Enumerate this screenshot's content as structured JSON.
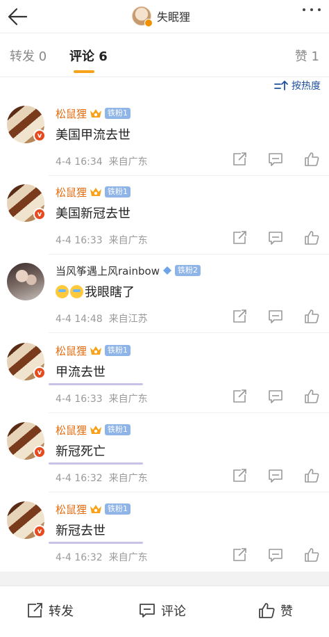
{
  "header": {
    "title": "失眠狸",
    "back_icon": "arrow-left-icon",
    "more_icon": "more-dots-icon"
  },
  "tabs": {
    "repost_label": "转发",
    "repost_count": "0",
    "comment_label": "评论",
    "comment_count": "6",
    "like_label": "赞",
    "like_count": "1",
    "active_color": "#f7a21a"
  },
  "sort": {
    "label": "按热度"
  },
  "colors": {
    "username": "#e86b0e",
    "fan_badge": "#8eb4e8",
    "highlight": "#c9c1e8"
  },
  "comments": [
    {
      "username": "松鼠狸",
      "fan_badge": "铁粉1",
      "text": "美国甲流去世",
      "time": "4-4 16:34",
      "location": "来自广东"
    },
    {
      "username": "松鼠狸",
      "fan_badge": "铁粉1",
      "text": "美国新冠去世",
      "time": "4-4 16:33",
      "location": "来自广东"
    },
    {
      "username": "当风筝遇上风rainbow",
      "fan_badge": "铁粉2",
      "text": "我眼瞎了",
      "time": "4-4 14:48",
      "location": "来自江苏"
    },
    {
      "username": "松鼠狸",
      "fan_badge": "铁粉1",
      "text": "甲流去世",
      "time": "4-4 16:33",
      "location": "来自广东"
    },
    {
      "username": "松鼠狸",
      "fan_badge": "铁粉1",
      "text": "新冠死亡",
      "time": "4-4 16:32",
      "location": "来自广东"
    },
    {
      "username": "松鼠狸",
      "fan_badge": "铁粉1",
      "text": "新冠去世",
      "time": "4-4 16:32",
      "location": "来自广东"
    }
  ],
  "bottom": {
    "repost_label": "转发",
    "comment_label": "评论",
    "like_label": "赞"
  }
}
